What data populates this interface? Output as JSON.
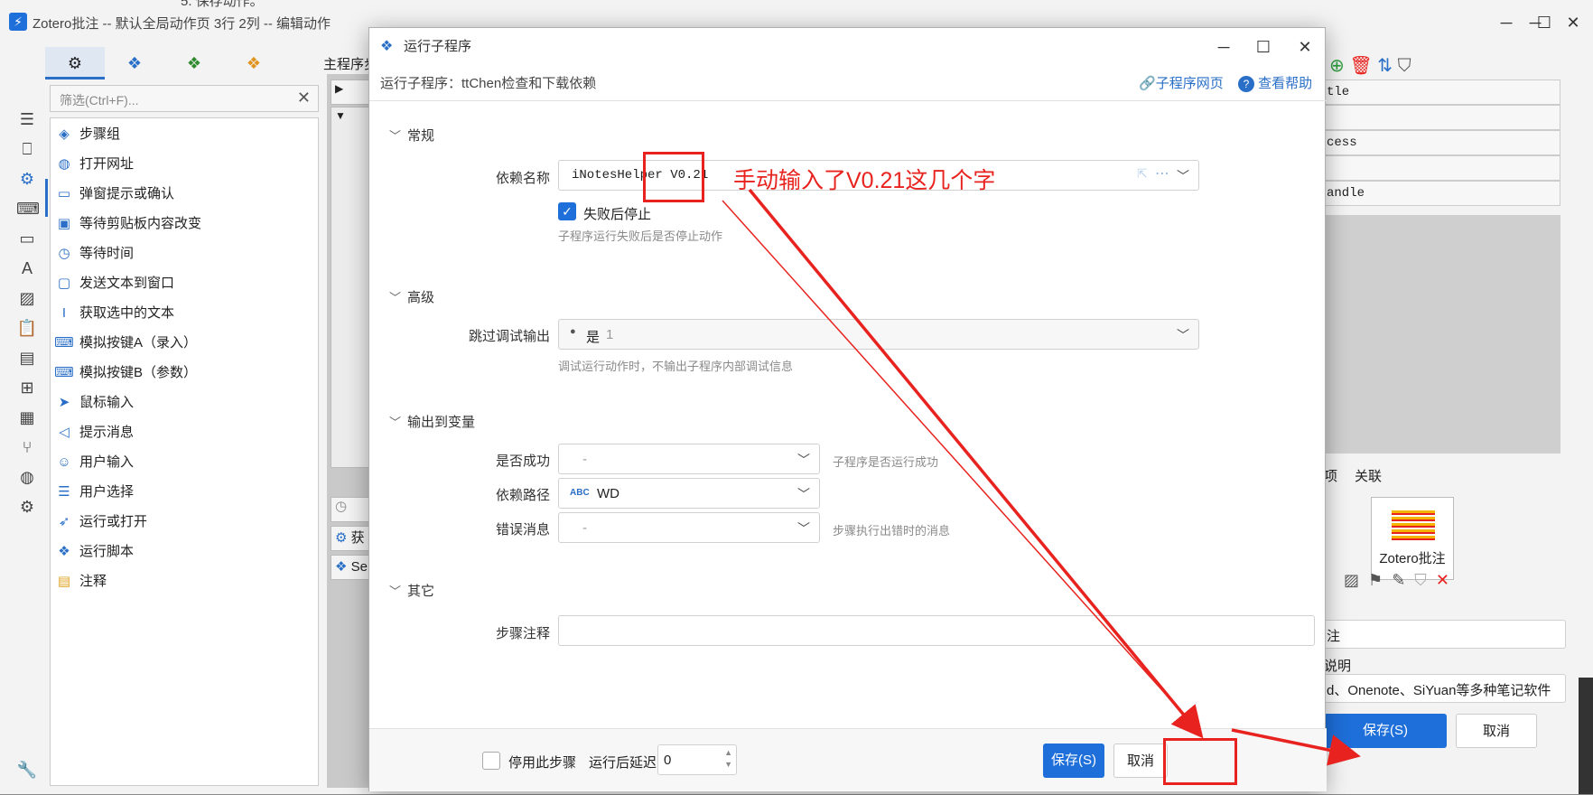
{
  "window": {
    "title": "Zotero批注 -- 默认全局动作页 3行 2列 -- 编辑动作",
    "behind_text": "5. 保存动作。",
    "minimize": "─",
    "maximize": "☐",
    "close": "✕"
  },
  "filter": {
    "placeholder": "筛选(Ctrl+F)..."
  },
  "steps": [
    {
      "label": "步骤组",
      "icon": "layers-icon"
    },
    {
      "label": "打开网址",
      "icon": "globe-icon"
    },
    {
      "label": "弹窗提示或确认",
      "icon": "dialog-icon"
    },
    {
      "label": "等待剪贴板内容改变",
      "icon": "clipboard-icon"
    },
    {
      "label": "等待时间",
      "icon": "timer-icon"
    },
    {
      "label": "发送文本到窗口",
      "icon": "message-icon"
    },
    {
      "label": "获取选中的文本",
      "icon": "text-cursor-icon"
    },
    {
      "label": "模拟按键A（录入）",
      "icon": "keyboard-icon"
    },
    {
      "label": "模拟按键B（参数）",
      "icon": "keyboard-icon"
    },
    {
      "label": "鼠标输入",
      "icon": "cursor-icon"
    },
    {
      "label": "提示消息",
      "icon": "megaphone-icon"
    },
    {
      "label": "用户输入",
      "icon": "user-icon"
    },
    {
      "label": "用户选择",
      "icon": "list-icon"
    },
    {
      "label": "运行或打开",
      "icon": "send-icon"
    },
    {
      "label": "运行脚本",
      "icon": "script-icon"
    },
    {
      "label": "注释",
      "icon": "note-icon"
    }
  ],
  "middle": {
    "label": "主程序步",
    "row1": "获",
    "row2": "Se"
  },
  "right": {
    "cells": [
      "tle",
      "",
      "cess",
      "",
      "andle"
    ],
    "tab_left": "项",
    "tab_right": "关联",
    "thumb_label": "Zotero批注",
    "field1": "注",
    "label2": "说明",
    "field2": "d、Onenote、SiYuan等多种笔记软件",
    "save": "保存(S)",
    "cancel": "取消"
  },
  "dialog": {
    "title": "运行子程序",
    "subtitle": "运行子程序：ttChen检查和下载依赖",
    "link_web": "子程序网页",
    "link_help": "查看帮助",
    "section_general": "常规",
    "dep_name_label": "依赖名称",
    "dep_name_value": "iNotesHelper V0.21",
    "stop_on_fail_label": "失败后停止",
    "stop_on_fail_hint": "子程序运行失败后是否停止动作",
    "section_advanced": "高级",
    "skip_debug_label": "跳过调试输出",
    "skip_debug_value": "是",
    "skip_debug_num": "1",
    "skip_debug_hint": "调试运行动作时，不输出子程序内部调试信息",
    "section_output": "输出到变量",
    "success_label": "是否成功",
    "success_value": "-",
    "success_hint": "子程序是否运行成功",
    "path_label": "依赖路径",
    "path_value": "WD",
    "path_badge": "ABC",
    "error_label": "错误消息",
    "error_value": "-",
    "error_hint": "步骤执行出错时的消息",
    "section_other": "其它",
    "note_label": "步骤注释",
    "note_value": "",
    "disable_label": "停用此步骤",
    "delay_label": "运行后延迟:",
    "delay_value": "0",
    "save": "保存(S)",
    "cancel": "取消"
  },
  "annotation": {
    "text": "手动输入了V0.21这几个字"
  },
  "colors": {
    "accent": "#1e6fd9",
    "annotation": "#e8231f"
  }
}
